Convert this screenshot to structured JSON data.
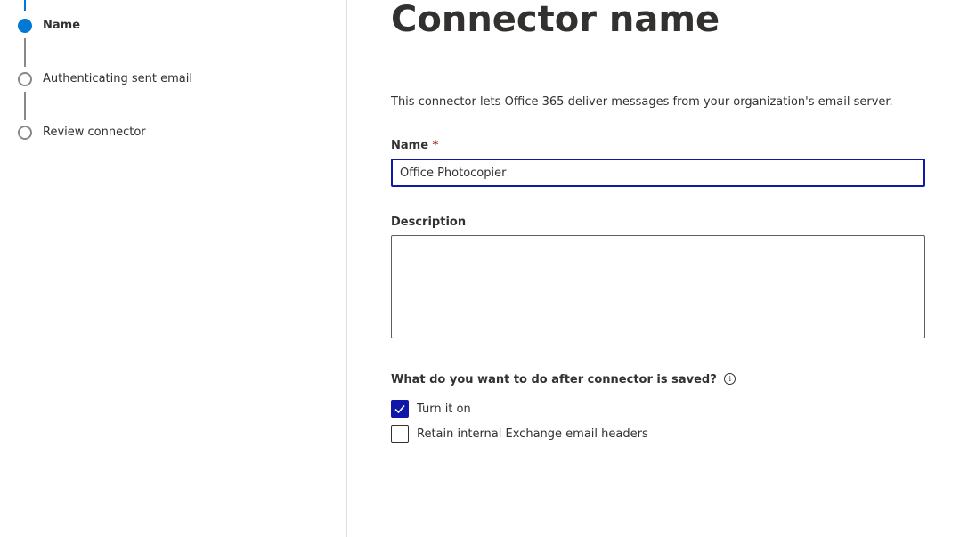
{
  "steps": [
    {
      "label": "Name",
      "state": "current"
    },
    {
      "label": "Authenticating sent email",
      "state": "pending"
    },
    {
      "label": "Review connector",
      "state": "pending"
    }
  ],
  "main": {
    "title": "Connector name",
    "intro": "This connector lets Office 365 deliver messages from your organization's email server.",
    "name_field": {
      "label": "Name",
      "required_mark": "*",
      "value": "Office Photocopier"
    },
    "description_field": {
      "label": "Description",
      "value": ""
    },
    "after_save": {
      "question": "What do you want to do after connector is saved?",
      "info_icon": "info-icon",
      "options": [
        {
          "label": "Turn it on",
          "checked": true
        },
        {
          "label": "Retain internal Exchange email headers",
          "checked": false
        }
      ]
    }
  },
  "colors": {
    "accent": "#0078d4",
    "focus_border": "#0f17a8",
    "required": "#a4262c",
    "text": "#323130",
    "step_inactive": "#8a8886"
  }
}
